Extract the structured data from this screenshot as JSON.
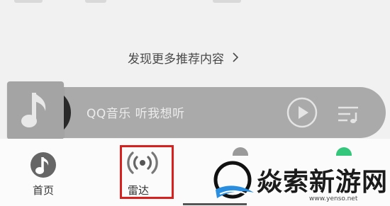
{
  "main": {
    "discover_more": "发现更多推荐内容"
  },
  "player": {
    "song_text": "QQ音乐 听我想听"
  },
  "tabbar": {
    "tabs": [
      {
        "label": "首页"
      },
      {
        "label": "雷达"
      }
    ],
    "highlight_color": "#d8201f"
  },
  "watermark": {
    "text": "焱索新游网",
    "url": "www.yenso.net"
  },
  "colors": {
    "background": "#f1f1f1",
    "player_bar": "#aaaaaa",
    "accent_green": "#34c77b"
  }
}
